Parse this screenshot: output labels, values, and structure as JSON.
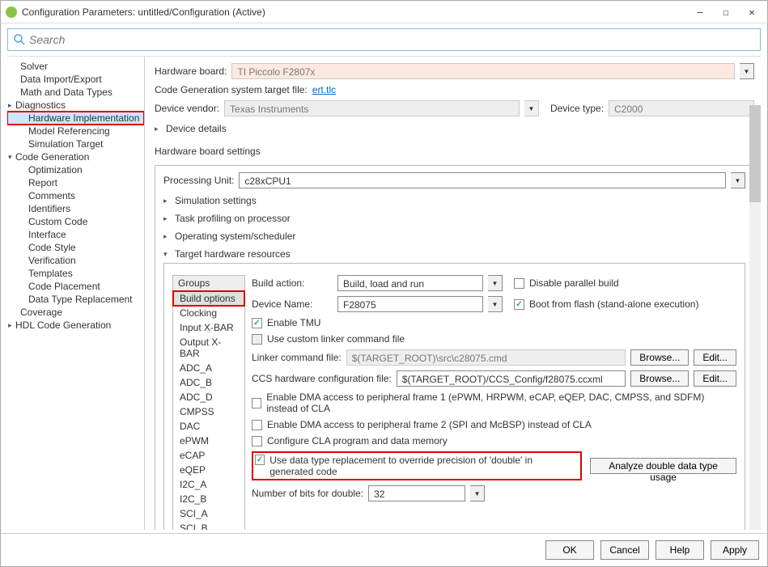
{
  "window": {
    "title": "Configuration Parameters: untitled/Configuration (Active)"
  },
  "search": {
    "placeholder": "Search"
  },
  "sidebar": {
    "items": [
      {
        "label": "Solver",
        "level": 0
      },
      {
        "label": "Data Import/Export",
        "level": 0
      },
      {
        "label": "Math and Data Types",
        "level": 0
      },
      {
        "label": "Diagnostics",
        "level": 0,
        "parent": true
      },
      {
        "label": "Hardware Implementation",
        "level": 1,
        "selected": true,
        "highlight": true
      },
      {
        "label": "Model Referencing",
        "level": 1
      },
      {
        "label": "Simulation Target",
        "level": 1
      },
      {
        "label": "Code Generation",
        "level": 0,
        "parent": true,
        "expanded": true
      },
      {
        "label": "Optimization",
        "level": 1
      },
      {
        "label": "Report",
        "level": 1
      },
      {
        "label": "Comments",
        "level": 1
      },
      {
        "label": "Identifiers",
        "level": 1
      },
      {
        "label": "Custom Code",
        "level": 1
      },
      {
        "label": "Interface",
        "level": 1
      },
      {
        "label": "Code Style",
        "level": 1
      },
      {
        "label": "Verification",
        "level": 1
      },
      {
        "label": "Templates",
        "level": 1
      },
      {
        "label": "Code Placement",
        "level": 1
      },
      {
        "label": "Data Type Replacement",
        "level": 1
      },
      {
        "label": "Coverage",
        "level": 0
      },
      {
        "label": "HDL Code Generation",
        "level": 0,
        "parent": true
      }
    ]
  },
  "main": {
    "hardware_board_label": "Hardware board:",
    "hardware_board_value": "TI Piccolo F2807x",
    "codegen_label": "Code Generation system target file:",
    "codegen_link": "ert.tlc",
    "device_vendor_label": "Device vendor:",
    "device_vendor_value": "Texas Instruments",
    "device_type_label": "Device type:",
    "device_type_value": "C2000",
    "device_details": "Device details",
    "hw_settings_title": "Hardware board settings",
    "processing_unit_label": "Processing Unit:",
    "processing_unit_value": "c28xCPU1",
    "sections": {
      "sim": "Simulation settings",
      "task": "Task profiling on processor",
      "os": "Operating system/scheduler",
      "target": "Target hardware resources"
    },
    "groups_header": "Groups",
    "groups": [
      "Build options",
      "Clocking",
      "Input X-BAR",
      "Output X-BAR",
      "ADC_A",
      "ADC_B",
      "ADC_D",
      "CMPSS",
      "DAC",
      "ePWM",
      "eCAP",
      "eQEP",
      "I2C_A",
      "I2C_B",
      "SCI_A",
      "SCI_B"
    ],
    "build": {
      "build_action_label": "Build action:",
      "build_action_value": "Build, load and run",
      "disable_parallel_label": "Disable parallel build",
      "device_name_label": "Device Name:",
      "device_name_value": "F28075",
      "boot_label": "Boot from flash (stand-alone execution)",
      "enable_tmu_label": "Enable TMU",
      "custom_linker_label": "Use custom linker command file",
      "linker_label": "Linker command file:",
      "linker_value": "$(TARGET_ROOT)\\src\\c28075.cmd",
      "ccs_label": "CCS hardware configuration file:",
      "ccs_value": "$(TARGET_ROOT)/CCS_Config/f28075.ccxml",
      "browse": "Browse...",
      "edit": "Edit...",
      "dma1_label": "Enable DMA access to peripheral frame 1 (ePWM, HRPWM, eCAP, eQEP, DAC, CMPSS, and SDFM) instead of CLA",
      "dma2_label": "Enable DMA access to peripheral frame 2 (SPI and McBSP) instead of CLA",
      "cla_label": "Configure CLA program and data memory",
      "dtr_label": "Use data type replacement to override precision of 'double' in generated code",
      "analyze_btn": "Analyze double data type usage",
      "bits_label": "Number of bits for double:",
      "bits_value": "32"
    }
  },
  "footer": {
    "ok": "OK",
    "cancel": "Cancel",
    "help": "Help",
    "apply": "Apply"
  }
}
